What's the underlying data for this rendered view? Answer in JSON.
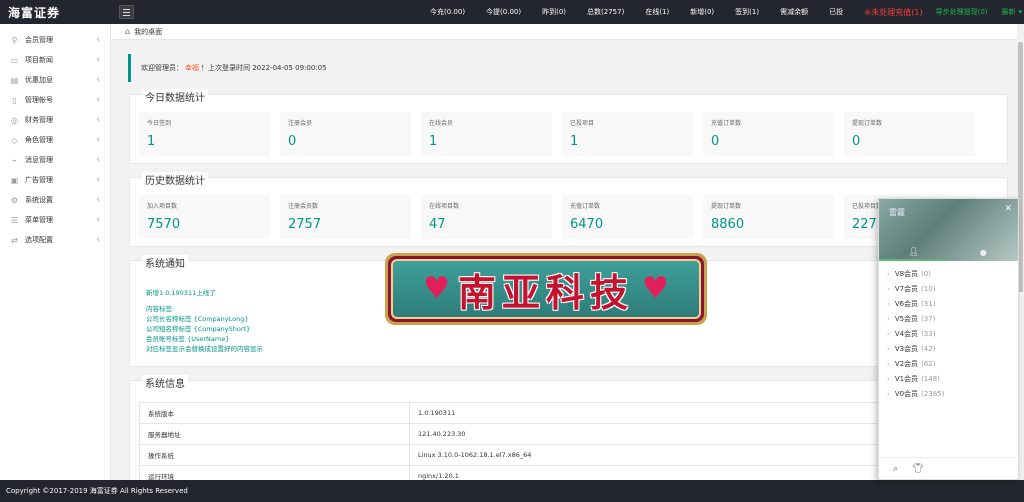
{
  "app": {
    "logo": "海富证券"
  },
  "topbar": {
    "stats": [
      "今充(0.00)",
      "今提(0.00)",
      "昨到(0)",
      "总数(2757)",
      "在线(1)",
      "新增(0)",
      "签到(1)",
      "需减余额",
      "已投"
    ],
    "alert": "④未处理充值(1)",
    "alert2": "导步处理提现(0)",
    "user": "最新",
    "colors": {
      "bar": "#23262e",
      "alert": "#ff3b3b",
      "green": "#1fb84a"
    }
  },
  "sidebar": {
    "items": [
      {
        "label": "会员管理",
        "icon": "user-icon"
      },
      {
        "label": "项目新闻",
        "icon": "news-icon"
      },
      {
        "label": "优惠加息",
        "icon": "coupon-icon"
      },
      {
        "label": "管理帐号",
        "icon": "account-icon"
      },
      {
        "label": "财务管理",
        "icon": "finance-icon"
      },
      {
        "label": "角色管理",
        "icon": "role-icon"
      },
      {
        "label": "消息管理",
        "icon": "message-icon"
      },
      {
        "label": "广告管理",
        "icon": "ad-icon"
      },
      {
        "label": "系统设置",
        "icon": "settings-icon"
      },
      {
        "label": "菜单管理",
        "icon": "menu-icon"
      },
      {
        "label": "选项配置",
        "icon": "options-icon"
      }
    ]
  },
  "breadcrumb": {
    "label": "我的桌面"
  },
  "welcome": {
    "prefix": "欢迎管理员：",
    "name": "幸福",
    "suffix": "！上次登录时间 2022-04-05 09:00:05"
  },
  "today": {
    "title": "今日数据统计",
    "cards": [
      {
        "label": "今日签到",
        "value": "1"
      },
      {
        "label": "注册会员",
        "value": "0"
      },
      {
        "label": "在线会员",
        "value": "1"
      },
      {
        "label": "已投项目",
        "value": "1"
      },
      {
        "label": "充值订单数",
        "value": "0"
      },
      {
        "label": "提现订单数",
        "value": "0"
      }
    ]
  },
  "history": {
    "title": "历史数据统计",
    "cards": [
      {
        "label": "加入项目数",
        "value": "7570"
      },
      {
        "label": "注册会员数",
        "value": "2757"
      },
      {
        "label": "在线项目数",
        "value": "47"
      },
      {
        "label": "充值订单数",
        "value": "6470"
      },
      {
        "label": "提现订单数",
        "value": "8860"
      },
      {
        "label": "已投项目数",
        "value": "227"
      }
    ]
  },
  "notice": {
    "title": "系统通知",
    "update": "新增1.0.190311上线了",
    "lines": [
      "内容标签:",
      "公司长名称标签 {CompanyLong}",
      "公司短名称标签 {CompanyShort}",
      "会员账号标签 {UserName}",
      "对应标签显示会替换成设置好的内容显示"
    ]
  },
  "sysinfo": {
    "title": "系统信息",
    "rows": [
      {
        "key": "系统版本",
        "value": "1.0.190311"
      },
      {
        "key": "服务器地址",
        "value": "121.40.223.30"
      },
      {
        "key": "操作系统",
        "value": "Linux 3.10.0-1062.18.1.el7.x86_64"
      },
      {
        "key": "运行环境",
        "value": "nginx/1.20.1"
      }
    ]
  },
  "footer": {
    "text": "Copyright ©2017-2019 海富证券 All Rights Reserved"
  },
  "banner": {
    "text": "南亚科技"
  },
  "widget": {
    "title": "雷霆",
    "groups": [
      {
        "name": "V8会员",
        "count": "(0)"
      },
      {
        "name": "V7会员",
        "count": "(10)"
      },
      {
        "name": "V6会员",
        "count": "(31)"
      },
      {
        "name": "V5会员",
        "count": "(37)"
      },
      {
        "name": "V4会员",
        "count": "(33)"
      },
      {
        "name": "V3会员",
        "count": "(42)"
      },
      {
        "name": "V2会员",
        "count": "(62)"
      },
      {
        "name": "V1会员",
        "count": "(148)"
      },
      {
        "name": "V0会员",
        "count": "(2385)"
      }
    ]
  }
}
